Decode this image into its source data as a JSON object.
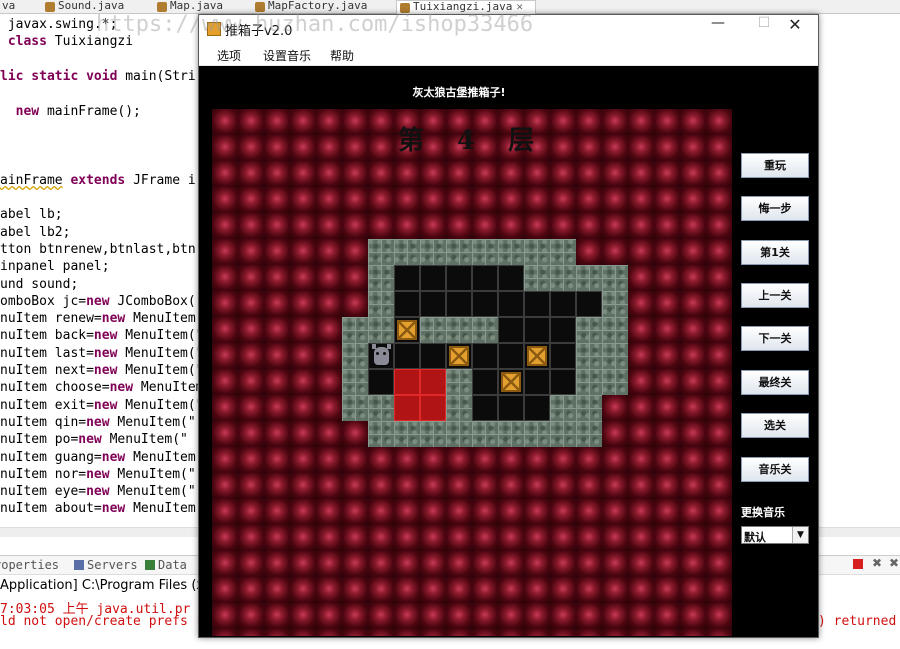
{
  "editor": {
    "tabs": [
      {
        "label": "va",
        "active": false
      },
      {
        "label": "Sound.java",
        "active": false
      },
      {
        "label": "Map.java",
        "active": false
      },
      {
        "label": "MapFactory.java",
        "active": false
      },
      {
        "label": "Tuixiangzi.java",
        "active": true,
        "close": "✕"
      }
    ],
    "watermark": "https://www.huzhan.com/ishop33466",
    "code": [
      {
        "parts": [
          {
            "t": " javax.swing.*;"
          }
        ]
      },
      {
        "parts": [
          {
            "t": " class ",
            "k": 1
          },
          {
            "t": "Tuixiangzi"
          }
        ]
      },
      {
        "parts": []
      },
      {
        "parts": [
          {
            "t": "lic static void ",
            "k": 1
          },
          {
            "t": "main(Stri"
          }
        ]
      },
      {
        "parts": []
      },
      {
        "parts": [
          {
            "t": "  new ",
            "k": 1
          },
          {
            "t": "mainFrame();"
          }
        ]
      },
      {
        "parts": []
      },
      {
        "parts": []
      },
      {
        "parts": []
      },
      {
        "parts": [
          {
            "t": "ainFrame",
            "u": 1
          },
          {
            "t": " extends ",
            "k": 1
          },
          {
            "t": "JFrame i"
          }
        ]
      },
      {
        "parts": []
      },
      {
        "parts": [
          {
            "t": "abel lb;"
          }
        ]
      },
      {
        "parts": [
          {
            "t": "abel lb2;"
          }
        ]
      },
      {
        "parts": [
          {
            "t": "tton btnrenew,btnlast,btn"
          }
        ]
      },
      {
        "parts": [
          {
            "t": "inpanel panel;"
          }
        ]
      },
      {
        "parts": [
          {
            "t": "und sound;"
          }
        ]
      },
      {
        "parts": [
          {
            "t": "omboBox jc="
          },
          {
            "t": "new ",
            "k": 1
          },
          {
            "t": "JComboBox()"
          }
        ]
      },
      {
        "parts": [
          {
            "t": "nuItem renew="
          },
          {
            "t": "new ",
            "k": 1
          },
          {
            "t": "MenuItem("
          }
        ]
      },
      {
        "parts": [
          {
            "t": "nuItem back="
          },
          {
            "t": "new ",
            "k": 1
          },
          {
            "t": "MenuItem(\""
          }
        ]
      },
      {
        "parts": [
          {
            "t": "nuItem last="
          },
          {
            "t": "new ",
            "k": 1
          },
          {
            "t": "MenuItem(\""
          }
        ]
      },
      {
        "parts": [
          {
            "t": "nuItem next="
          },
          {
            "t": "new ",
            "k": 1
          },
          {
            "t": "MenuItem(\""
          }
        ]
      },
      {
        "parts": [
          {
            "t": "nuItem choose="
          },
          {
            "t": "new ",
            "k": 1
          },
          {
            "t": "MenuItem"
          }
        ]
      },
      {
        "parts": [
          {
            "t": "nuItem exit="
          },
          {
            "t": "new ",
            "k": 1
          },
          {
            "t": "MenuItem(\""
          }
        ]
      },
      {
        "parts": [
          {
            "t": "nuItem qin="
          },
          {
            "t": "new ",
            "k": 1
          },
          {
            "t": "MenuItem(\""
          }
        ]
      },
      {
        "parts": [
          {
            "t": "nuItem po="
          },
          {
            "t": "new ",
            "k": 1
          },
          {
            "t": "MenuItem(\""
          }
        ]
      },
      {
        "parts": [
          {
            "t": "nuItem guang="
          },
          {
            "t": "new ",
            "k": 1
          },
          {
            "t": "MenuItem("
          }
        ]
      },
      {
        "parts": [
          {
            "t": "nuItem nor="
          },
          {
            "t": "new ",
            "k": 1
          },
          {
            "t": "MenuItem(\""
          }
        ]
      },
      {
        "parts": [
          {
            "t": "nuItem eye="
          },
          {
            "t": "new ",
            "k": 1
          },
          {
            "t": "MenuItem(\""
          }
        ]
      },
      {
        "parts": [
          {
            "t": "nuItem about="
          },
          {
            "t": "new ",
            "k": 1
          },
          {
            "t": "MenuItem("
          }
        ]
      }
    ],
    "views": {
      "properties": "roperties",
      "servers": "Servers",
      "data": "Data"
    },
    "console": {
      "title": " Application] C:\\Program Files (x",
      "line1": " 7:03:05 上午 java.util.pr",
      "line2": "ld not open/create prefs r",
      "line2_right": ") returned"
    }
  },
  "window": {
    "title": "推箱子v2.0",
    "min": "—",
    "max": "☐",
    "close": "✕",
    "menus": [
      "选项",
      "设置音乐",
      "帮助"
    ]
  },
  "game": {
    "caption": "灰太狼古堡推箱子!",
    "level": {
      "prefix": "第",
      "number": "4",
      "suffix": "层"
    },
    "grid_rows": [
      "..WWWWWWWW...",
      "..WFFFFFWWWW.",
      "..WFFFFFFFFW.",
      ".WWBWWWFFFWW.",
      ".WPFFBFFBFWW.",
      ".WFTTWFBFFWW.",
      ".WWTTWFFFWW..",
      "..WWWWWWWWW.."
    ],
    "legend": {
      "W": "wall",
      "F": "floor",
      "T": "target",
      "B": "box",
      "P": "player"
    },
    "buttons": [
      "重玩",
      "悔一步",
      "第1关",
      "上一关",
      "下一关",
      "最终关",
      "选关",
      "音乐关"
    ],
    "music_label": "更换音乐",
    "music_value": "默认",
    "music_arrow": "▼"
  },
  "colors": {
    "board_red": "#8a1a2d",
    "wall": "#5f7165",
    "target": "#b01414",
    "box": "#e4a02e",
    "keyword": "#7f0055",
    "console_error": "#d01010"
  }
}
